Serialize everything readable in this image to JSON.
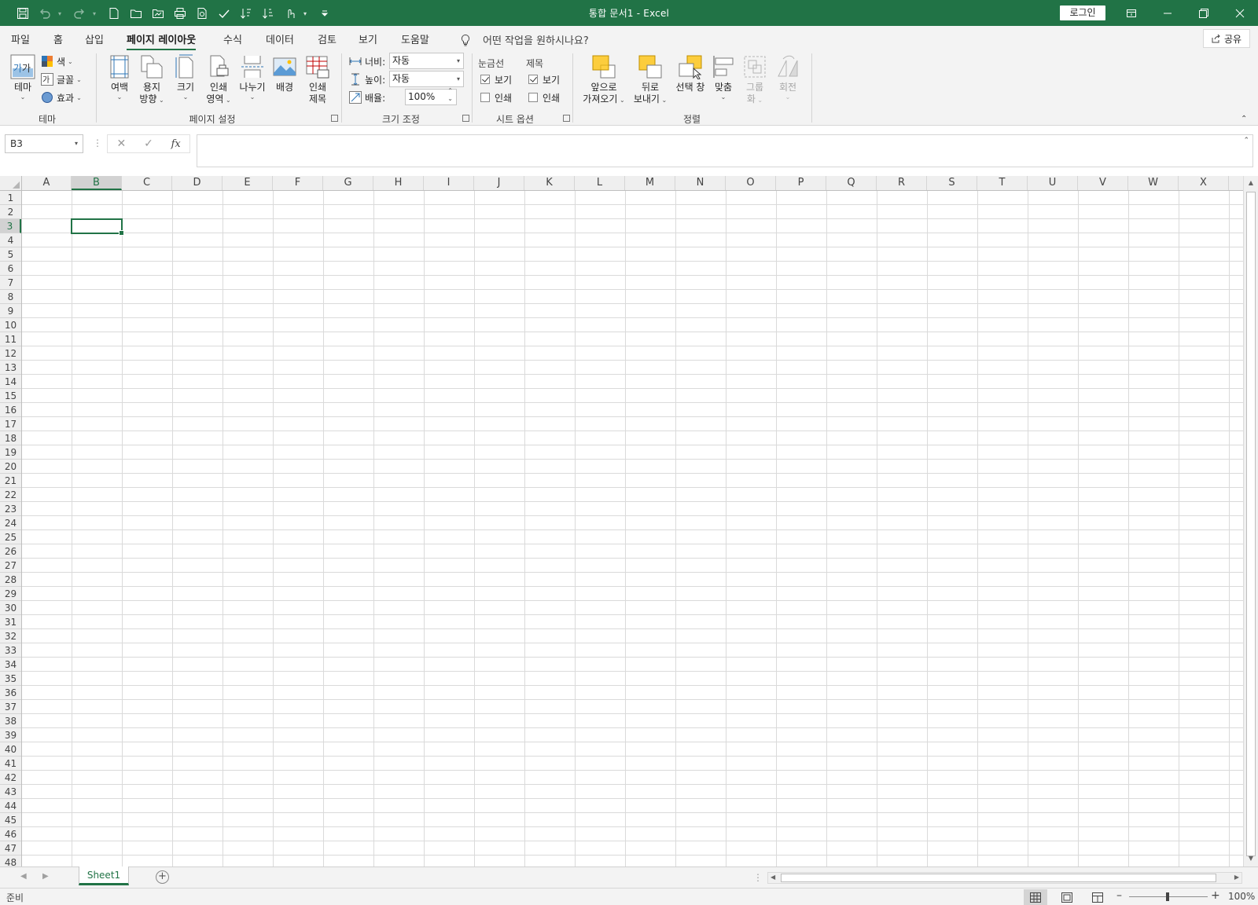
{
  "app": {
    "document_title": "통합 문서1  -  Excel",
    "login_label": "로그인",
    "accent": "#217346"
  },
  "quick_access": [
    "save-icon",
    "undo-icon",
    "redo-icon",
    "new-file-icon",
    "open-folder-icon",
    "open-icon",
    "print-icon",
    "print-preview-icon",
    "spelling-icon",
    "sort-ascending-icon",
    "sort-descending-icon",
    "touch-mode-icon",
    "customize-icon"
  ],
  "tabs": [
    {
      "label": "파일"
    },
    {
      "label": "홈"
    },
    {
      "label": "삽입"
    },
    {
      "label": "페이지 레이아웃"
    },
    {
      "label": "수식"
    },
    {
      "label": "데이터"
    },
    {
      "label": "검토"
    },
    {
      "label": "보기"
    },
    {
      "label": "도움말"
    }
  ],
  "active_tab": "페이지 레이아웃",
  "tell_me": "어떤 작업을 원하시나요?",
  "share_label": "공유",
  "ribbon": {
    "theme": {
      "group_label": "테마",
      "themes_label": "테마",
      "colors_label": "색",
      "fonts_label": "글꼴",
      "effects_label": "효과"
    },
    "page_setup": {
      "group_label": "페이지 설정",
      "margins": "여백",
      "orientation_1": "용지",
      "orientation_2": "방향",
      "size": "크기",
      "print_area_1": "인쇄",
      "print_area_2": "영역",
      "breaks": "나누기",
      "background": "배경",
      "print_titles_1": "인쇄",
      "print_titles_2": "제목"
    },
    "scale": {
      "group_label": "크기 조정",
      "width_label": "너비:",
      "width_value": "자동",
      "height_label": "높이:",
      "height_value": "자동",
      "scale_label": "배율:",
      "scale_value": "100%"
    },
    "sheet_options": {
      "group_label": "시트 옵션",
      "gridlines_header": "눈금선",
      "headings_header": "제목",
      "gridlines_view": "보기",
      "gridlines_print": "인쇄",
      "headings_view": "보기",
      "headings_print": "인쇄",
      "gridlines_view_checked": true,
      "gridlines_print_checked": false,
      "headings_view_checked": true,
      "headings_print_checked": false
    },
    "arrange": {
      "group_label": "정렬",
      "bring_forward_1": "앞으로",
      "bring_forward_2": "가져오기",
      "send_backward_1": "뒤로",
      "send_backward_2": "보내기",
      "selection_pane": "선택 창",
      "align": "맞춤",
      "group_1": "그룹",
      "group_2": "화",
      "rotate": "회전"
    }
  },
  "formula_bar": {
    "name_box": "B3",
    "formula": ""
  },
  "columns": [
    "A",
    "B",
    "C",
    "D",
    "E",
    "F",
    "G",
    "H",
    "I",
    "J",
    "K",
    "L",
    "M",
    "N",
    "O",
    "P",
    "Q",
    "R",
    "S",
    "T",
    "U",
    "V",
    "W",
    "X"
  ],
  "rows": [
    "1",
    "2",
    "3",
    "4",
    "5",
    "6",
    "7",
    "8",
    "9",
    "10",
    "11",
    "12",
    "13",
    "14",
    "15",
    "16",
    "17",
    "18",
    "19",
    "20",
    "21",
    "22",
    "23",
    "24",
    "25",
    "26",
    "27",
    "28",
    "29",
    "30",
    "31",
    "32",
    "33",
    "34",
    "35",
    "36",
    "37",
    "38",
    "39",
    "40",
    "41",
    "42",
    "43",
    "44",
    "45",
    "46",
    "47",
    "48"
  ],
  "selected_column": "B",
  "selected_row": "3",
  "sheets": [
    {
      "name": "Sheet1"
    }
  ],
  "status": {
    "ready": "준비",
    "zoom": "100%"
  }
}
